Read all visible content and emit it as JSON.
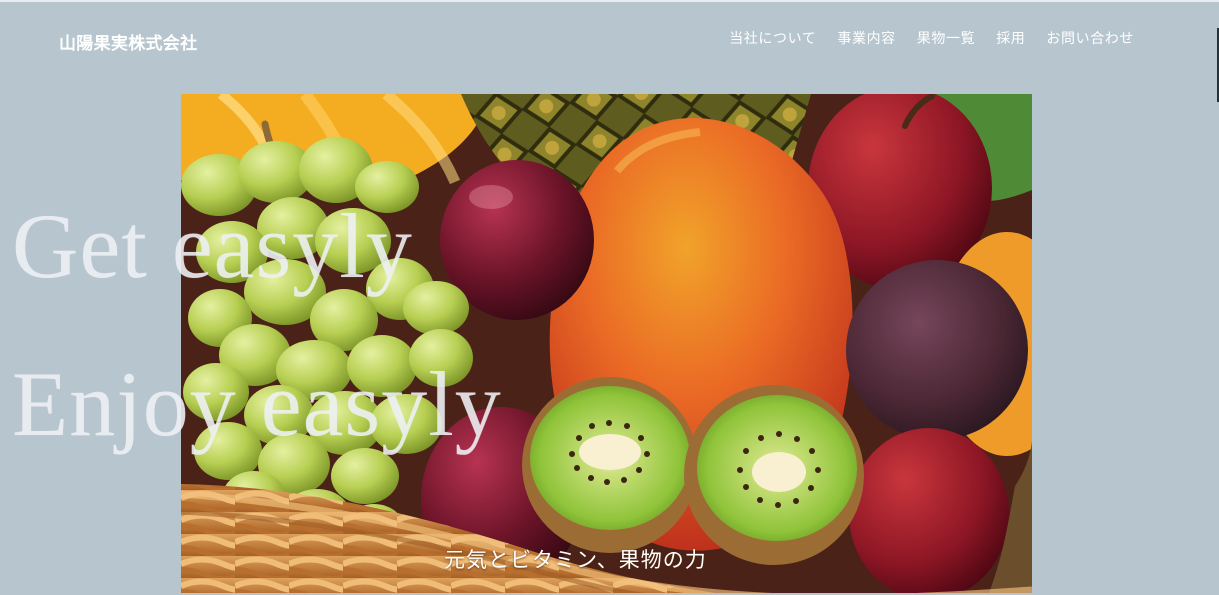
{
  "site": {
    "title": "山陽果実株式会社"
  },
  "nav": {
    "items": [
      {
        "label": "当社について"
      },
      {
        "label": "事業内容"
      },
      {
        "label": "果物一覧"
      },
      {
        "label": "採用"
      },
      {
        "label": "お問い合わせ"
      }
    ]
  },
  "hero": {
    "slogan_lines": [
      "Get easyly",
      "Enjoy easyly"
    ],
    "caption": "元気とビタミン、果物の力"
  },
  "colors": {
    "page_background": "#b7c5cf",
    "text": "#ffffff",
    "slogan_text": "#eceff3"
  }
}
